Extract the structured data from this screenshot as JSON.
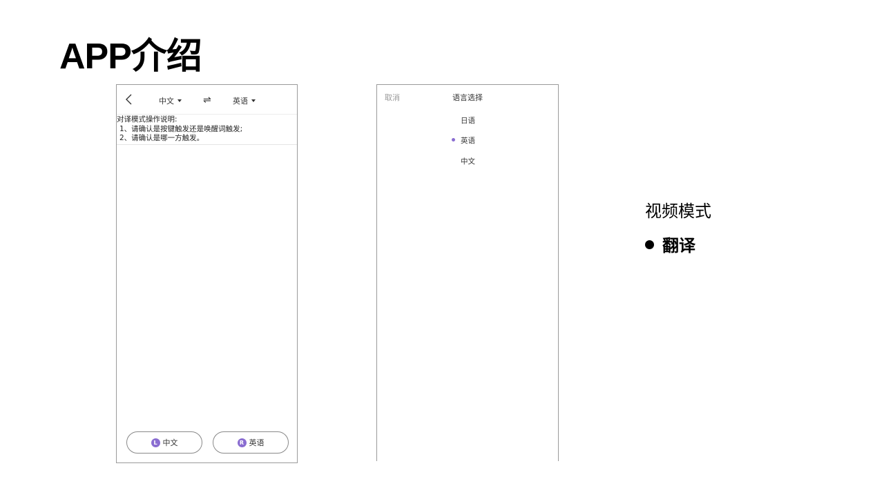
{
  "slide": {
    "title": "APP介绍"
  },
  "phone1": {
    "source_lang": "中文",
    "target_lang": "英语",
    "swap_icon": "⇌",
    "instructions": {
      "heading": "对译模式操作说明:",
      "line1": "1、请确认是按键触发还是唤醒词触发;",
      "line2": "2、请确认是哪一方触发。"
    },
    "left_button": {
      "badge": "L",
      "label": "中文"
    },
    "right_button": {
      "badge": "R",
      "label": "英语"
    }
  },
  "phone2": {
    "cancel_label": "取消",
    "title": "语言选择",
    "options": [
      "日语",
      "英语",
      "中文"
    ],
    "selected_option": "英语"
  },
  "notes": {
    "mode_title": "视频模式",
    "bullet": "翻译"
  },
  "colors": {
    "accent": "#8a6dd1"
  }
}
